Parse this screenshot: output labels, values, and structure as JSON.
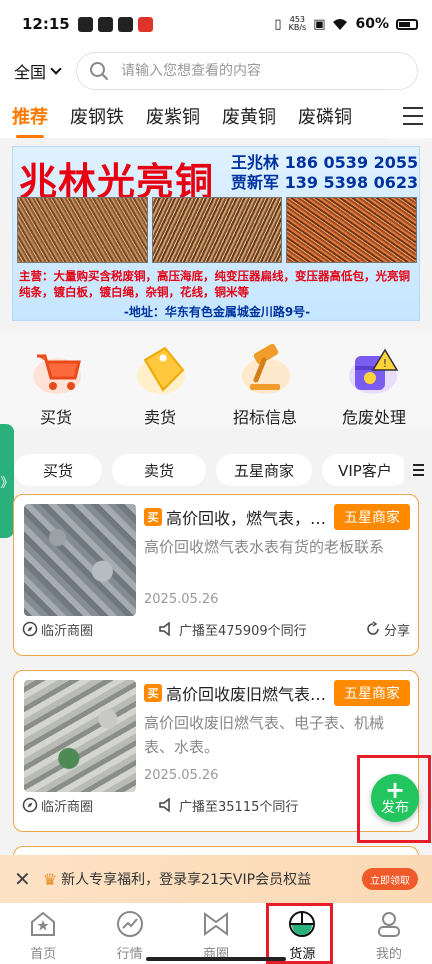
{
  "status_bar": {
    "time": "12:15",
    "speed_top": "453",
    "speed_bottom": "KB/s",
    "battery": "60%"
  },
  "search": {
    "region": "全国",
    "placeholder": "请输入您想查看的内容"
  },
  "category_tabs": [
    "推荐",
    "废钢铁",
    "废紫铜",
    "废黄铜",
    "废磷铜"
  ],
  "banner": {
    "title": "兆林光亮铜",
    "contact_1": "王兆林 186 0539 2055",
    "contact_2": "贾新军 139 5398 0623",
    "main_business": "主营：大量购买含税废铜，高压海底，纯变压器扁线，变压器高低包，光亮铜纯条，镀白板，镀白绳，杂铜，花线，铜米等",
    "address": "-地址：华东有色金属城金川路9号-"
  },
  "quick_menu": [
    {
      "label": "买货",
      "icon": "shopping-cart-icon"
    },
    {
      "label": "卖货",
      "icon": "price-tag-icon"
    },
    {
      "label": "招标信息",
      "icon": "gavel-icon"
    },
    {
      "label": "危废处理",
      "icon": "hazard-barrel-icon"
    }
  ],
  "edge_tab": "》",
  "filter_pills": [
    "买货",
    "卖货",
    "五星商家",
    "VIP客户"
  ],
  "cards": [
    {
      "type_badge": "买",
      "title": "高价回收，燃气表，…",
      "tag": "五星商家",
      "description": "高价回收燃气表水表有货的老板联系",
      "date": "2025.05.26",
      "circle": "临沂商圈",
      "broadcast": "广播至475909个同行",
      "share": "分享"
    },
    {
      "type_badge": "买",
      "title": "高价回收废旧燃气表…",
      "tag": "五星商家",
      "description": "高价回收废旧燃气表、电子表、机械表、水表。",
      "date": "2025.05.26",
      "circle": "临沂商圈",
      "broadcast": "广播至35115个同行"
    }
  ],
  "fab": {
    "plus": "+",
    "label": "发布"
  },
  "promo": {
    "close": "✕",
    "text": "新人专享福利，登录享21天VIP会员权益",
    "button": "立即领取"
  },
  "bottom_nav": [
    {
      "label": "首页",
      "icon": "home-icon"
    },
    {
      "label": "行情",
      "icon": "market-trend-icon"
    },
    {
      "label": "商圈",
      "icon": "business-circle-icon"
    },
    {
      "label": "货源",
      "icon": "crosshair-source-icon",
      "active": true
    },
    {
      "label": "我的",
      "icon": "profile-icon"
    }
  ]
}
